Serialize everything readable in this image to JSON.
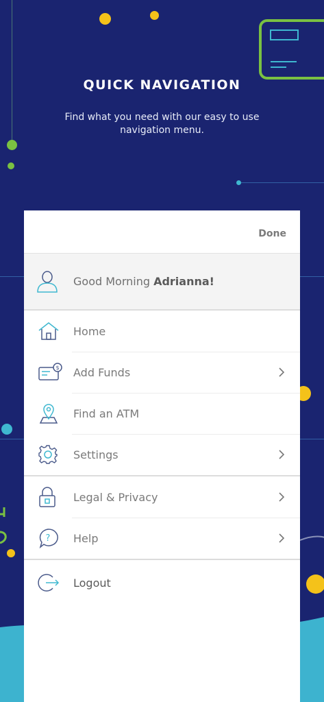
{
  "header": {
    "title": "QUICK NAVIGATION",
    "subtitle": "Find what you need with our easy to use navigation menu."
  },
  "menu": {
    "done_label": "Done",
    "greeting": {
      "prefix": "Good Morning ",
      "name": "Adrianna!"
    },
    "items": [
      {
        "label": "Home",
        "icon": "home-icon",
        "chevron": false
      },
      {
        "label": "Add Funds",
        "icon": "add-funds-icon",
        "chevron": true
      },
      {
        "label": "Find an ATM",
        "icon": "map-pin-icon",
        "chevron": false
      },
      {
        "label": "Settings",
        "icon": "gear-icon",
        "chevron": true
      }
    ],
    "secondary": [
      {
        "label": "Legal & Privacy",
        "icon": "lock-icon",
        "chevron": true
      },
      {
        "label": "Help",
        "icon": "help-icon",
        "chevron": true
      }
    ],
    "logout_label": "Logout"
  },
  "colors": {
    "background": "#1a2470",
    "accent_yellow": "#f4c21a",
    "accent_green": "#7ac142",
    "accent_teal": "#3fb8d0",
    "icon_outline": "#4a5a8a"
  }
}
